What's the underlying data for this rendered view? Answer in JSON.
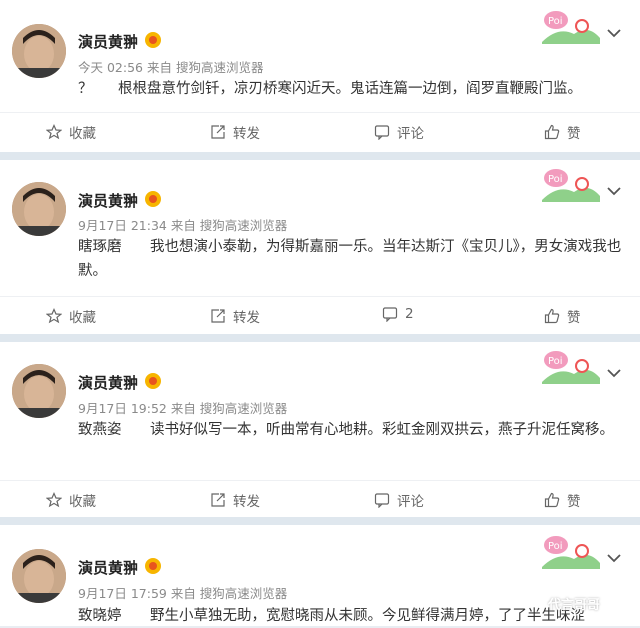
{
  "posts": [
    {
      "author": "演员黄翀",
      "time": "今天 02:56 来自 搜狗高速浏览器",
      "prefix": "？",
      "text": "根根盘意竹剑钎，凉刃桥寒闪近天。鬼话连篇一边倒，阎罗直鞭殿门监。",
      "actions": {
        "fav": "收藏",
        "repost": "转发",
        "comment": "评论",
        "like": "赞"
      }
    },
    {
      "author": "演员黄翀",
      "time": "9月17日 21:34 来自 搜狗高速浏览器",
      "prefix": "瞎琢磨",
      "text": "我也想演小泰勒，为得斯嘉丽一乐。当年达斯汀《宝贝儿》，男女演戏我也默。",
      "actions": {
        "fav": "收藏",
        "repost": "转发",
        "comment": "2",
        "like": "赞"
      }
    },
    {
      "author": "演员黄翀",
      "time": "9月17日 19:52 来自 搜狗高速浏览器",
      "prefix": "致燕姿",
      "text": "读书好似写一本，听曲常有心地耕。彩虹金刚双拱云，燕子升泥任窝移。",
      "actions": {
        "fav": "收藏",
        "repost": "转发",
        "comment": "评论",
        "like": "赞"
      }
    },
    {
      "author": "演员黄翀",
      "time": "9月17日 17:59 来自 搜狗高速浏览器",
      "prefix": "致晓婷",
      "text": "野生小草独无助，宽慰晓雨从未顾。今见鲜得满月婷，了了半生味涩"
    }
  ],
  "watermark": "代言哥哥"
}
